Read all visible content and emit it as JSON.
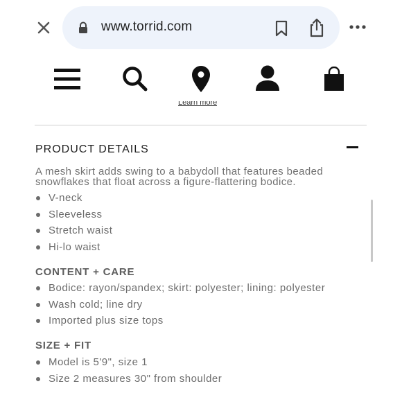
{
  "browser": {
    "url": "www.torrid.com"
  },
  "page": {
    "cut_link": "Learn more",
    "section_title": "PRODUCT DETAILS",
    "description": "A mesh skirt adds swing to a babydoll that features beaded snowflakes that float across a figure-flattering bodice.",
    "features": [
      "V-neck",
      "Sleeveless",
      "Stretch waist",
      "Hi-lo waist"
    ],
    "content_care": {
      "heading": "CONTENT + CARE",
      "items": [
        "Bodice: rayon/spandex; skirt: polyester; lining: polyester",
        "Wash cold; line dry",
        "Imported plus size tops"
      ]
    },
    "size_fit": {
      "heading": "SIZE + FIT",
      "items": [
        "Model is 5'9\", size 1",
        "Size 2 measures 30\" from shoulder"
      ]
    }
  },
  "colors": {
    "url_pill": "#eef3fb",
    "text_muted": "#6c6c6c",
    "icon": "#111111"
  }
}
